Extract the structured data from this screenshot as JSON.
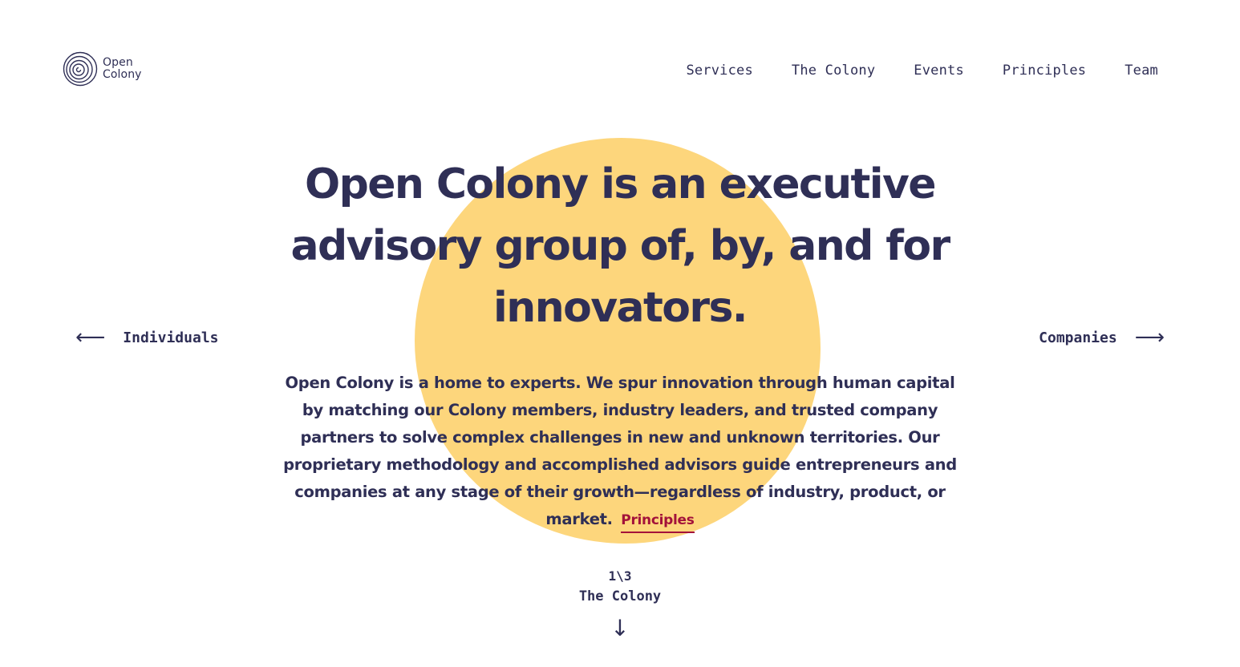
{
  "brand": {
    "line1": "Open",
    "line2": "Colony"
  },
  "nav": {
    "items": [
      "Services",
      "The Colony",
      "Events",
      "Principles",
      "Team"
    ]
  },
  "hero": {
    "title": "Open Colony is an executive advisory group of, by, and for innovators.",
    "body": "Open Colony is a home to experts. We spur innovation through human capital by matching our Colony members, industry leaders, and trusted company partners to solve complex challenges in new and unknown territories. Our proprietary methodology and accomplished advisors guide entrepreneurs and companies at any stage of their growth—regardless of industry, product, or market.",
    "link_label": "Principles"
  },
  "side_nav": {
    "prev_label": "Individuals",
    "prev_arrow": "⟵",
    "next_label": "Companies",
    "next_arrow": "⟶"
  },
  "pager": {
    "count": "1\\3",
    "label": "The Colony",
    "arrow": "↓"
  },
  "colors": {
    "text": "#2f2f56",
    "accent_blob": "#fdd67c",
    "link": "#a3123a",
    "background": "#ffffff"
  }
}
